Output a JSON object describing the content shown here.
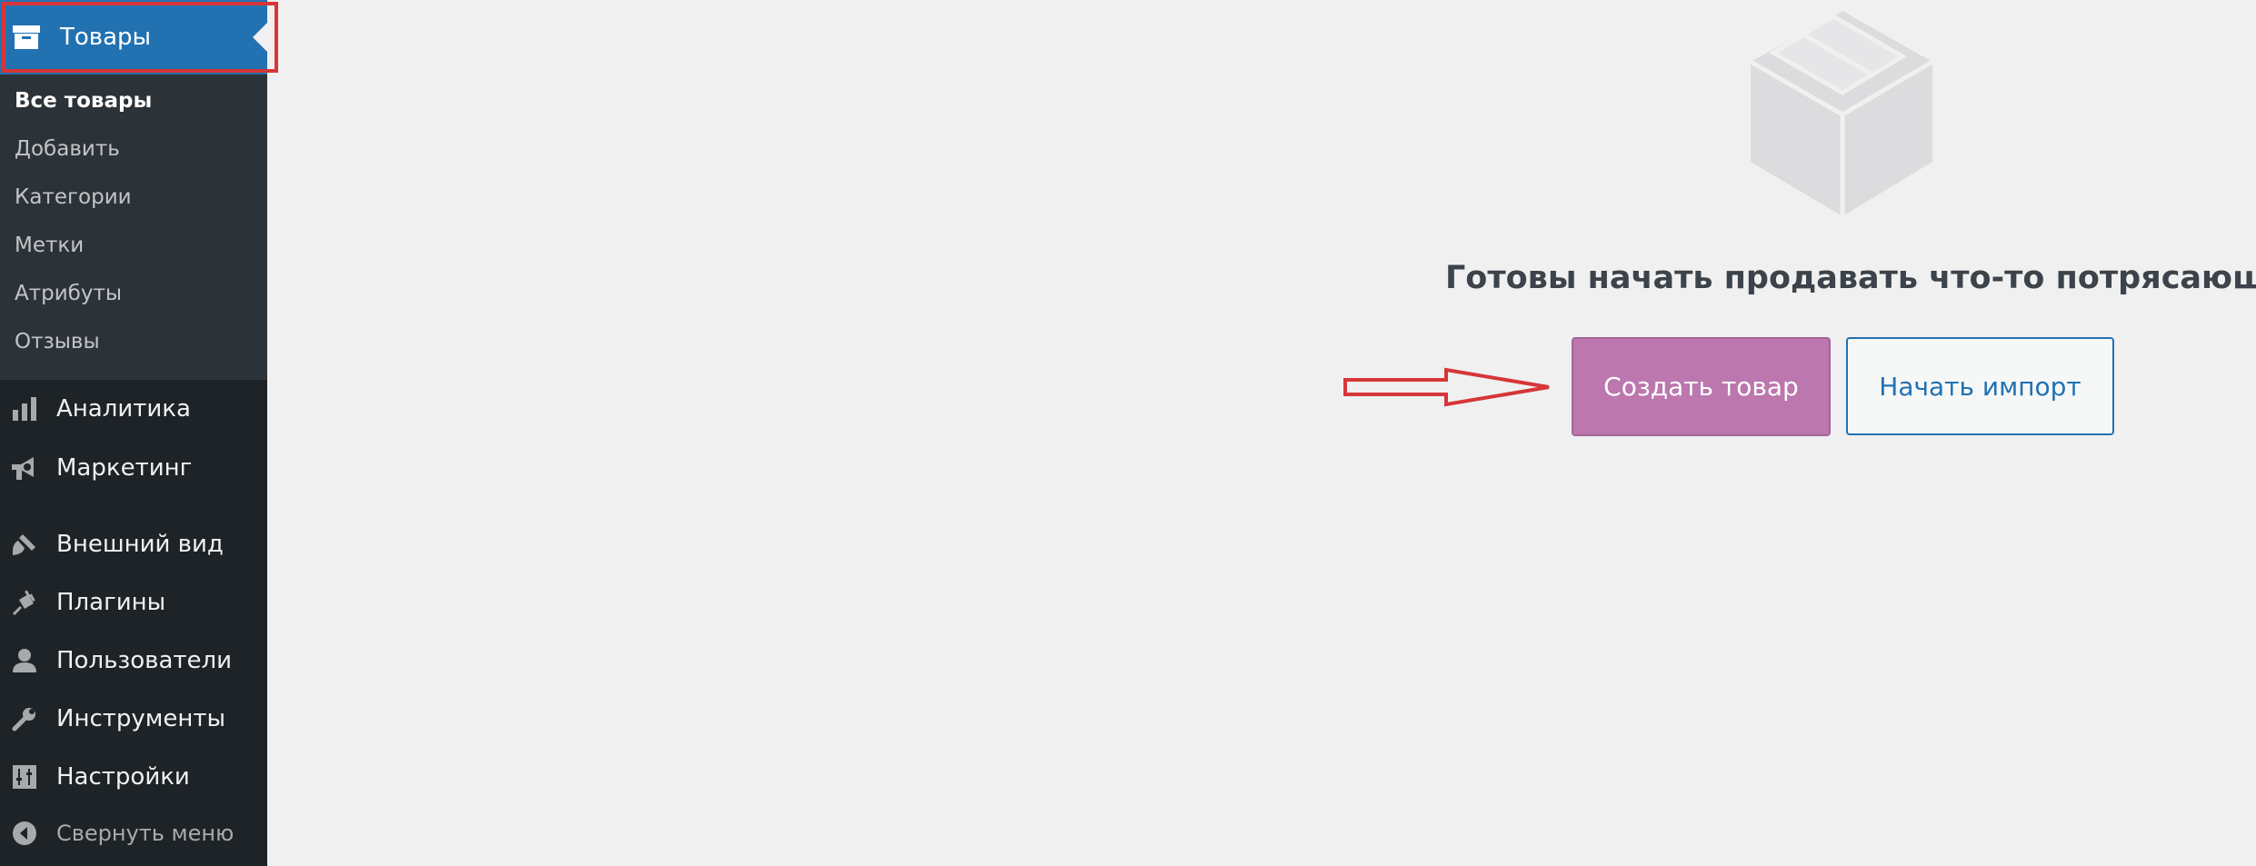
{
  "sidebar": {
    "current": {
      "label": "Товары",
      "icon": "archive-icon"
    },
    "submenu": [
      {
        "label": "Все товары",
        "active": true
      },
      {
        "label": "Добавить"
      },
      {
        "label": "Категории"
      },
      {
        "label": "Метки"
      },
      {
        "label": "Атрибуты"
      },
      {
        "label": "Отзывы"
      }
    ],
    "items": [
      {
        "label": "Аналитика",
        "icon": "bar-chart-icon"
      },
      {
        "label": "Маркетинг",
        "icon": "megaphone-icon"
      },
      {
        "label": "Внешний вид",
        "icon": "paintbrush-icon"
      },
      {
        "label": "Плагины",
        "icon": "plugin-icon"
      },
      {
        "label": "Пользователи",
        "icon": "user-icon"
      },
      {
        "label": "Инструменты",
        "icon": "wrench-icon"
      },
      {
        "label": "Настройки",
        "icon": "settings-sliders-icon"
      }
    ],
    "collapse": {
      "label": "Свернуть меню",
      "icon": "collapse-arrow-icon"
    }
  },
  "main": {
    "heading": "Готовы начать продавать что-то потрясающее?",
    "create_button": "Создать товар",
    "import_button": "Начать импорт"
  },
  "colors": {
    "sidebar_bg": "#1d2327",
    "submenu_bg": "#2c3338",
    "active_blue": "#2271b1",
    "create_button_bg": "#bb77ae",
    "annotation_red": "#d63638"
  }
}
